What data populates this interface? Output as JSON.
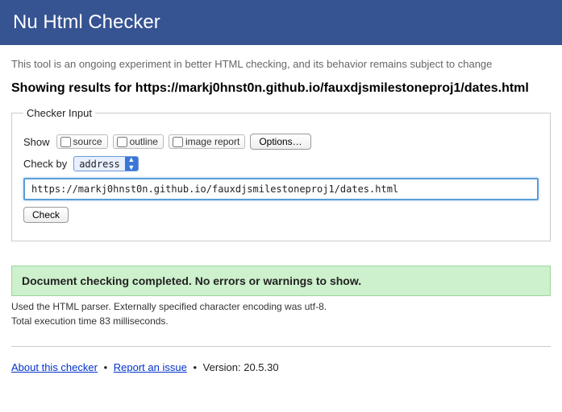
{
  "header": {
    "title": "Nu Html Checker"
  },
  "intro": "This tool is an ongoing experiment in better HTML checking, and its behavior remains subject to change",
  "results_heading": "Showing results for https://markj0hnst0n.github.io/fauxdjsmilestoneproj1/dates.html",
  "form": {
    "legend": "Checker Input",
    "show_label": "Show",
    "checkboxes": {
      "source": "source",
      "outline": "outline",
      "image_report": "image report"
    },
    "options_button": "Options…",
    "check_by_label": "Check by",
    "check_by_value": "address",
    "url_value": "https://markj0hnst0n.github.io/fauxdjsmilestoneproj1/dates.html",
    "check_button": "Check"
  },
  "result": {
    "success": "Document checking completed. No errors or warnings to show.",
    "parser_line": "Used the HTML parser. Externally specified character encoding was utf-8.",
    "time_line": "Total execution time 83 milliseconds."
  },
  "footer": {
    "about": "About this checker",
    "report": "Report an issue",
    "version_label": "Version: ",
    "version": "20.5.30"
  }
}
